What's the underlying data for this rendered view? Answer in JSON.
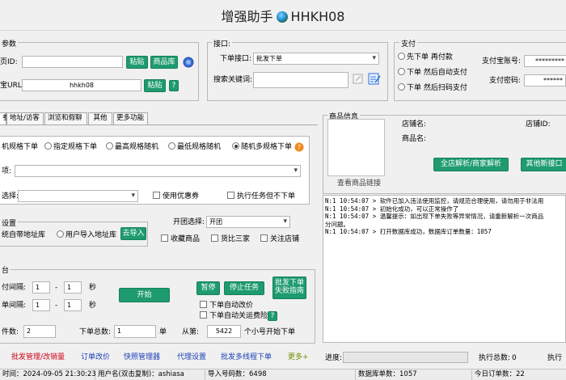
{
  "window": {
    "title_prefix": "增强助手",
    "title_suffix": "HHKH08"
  },
  "params": {
    "group_label": "参数",
    "page_url_label": "页ID:",
    "page_url_value": "",
    "paste_label": "粘贴",
    "product_lib_label": "商品库",
    "shop_url_label": "宝URL:",
    "shop_url_value": "hhkh08",
    "paste2_label": "粘贴",
    "help_label": "?"
  },
  "interface": {
    "group_label": "接口:",
    "order_interface_label": "下单接口:",
    "order_interface_value": "批发下单",
    "keyword_label": "搜索关键词:",
    "keyword_value": ""
  },
  "payment": {
    "group_label": "支付",
    "options": [
      "先下单 再付款",
      "下单 然后自动支付",
      "下单 然后扫码支付"
    ],
    "alipay_account_label": "支付宝账号:",
    "alipay_account_value": "*********",
    "pay_password_label": "支付密码:",
    "pay_password_value": "******"
  },
  "tabs": [
    "参",
    "地址/访客",
    "浏览和假聊",
    "其他",
    "更多功能"
  ],
  "spec": {
    "options": [
      "机规格下单",
      "指定规格下单",
      "最高规格随机",
      "最低规格随机",
      "随机多规格下单"
    ],
    "help": "?",
    "spec_label": "项:",
    "select_label": "选择:",
    "coupon_label": "使用优惠券",
    "exec_task_label": "执行任务但不下单"
  },
  "address": {
    "group_label": "设置",
    "opt1": "统自带地址库",
    "opt2": "用户导入地址库",
    "import_button": "去导入",
    "group_buy_label": "开团选择:",
    "group_buy_value": "开团",
    "fav_label": "收藏商品",
    "compare_label": "货比三家",
    "follow_label": "关注店铺"
  },
  "task": {
    "group_label": "台",
    "pay_interval_label": "付间隔:",
    "pay_interval_from": "1",
    "pay_interval_to": "1",
    "sec1": "秒",
    "order_interval_label": "单间隔:",
    "order_interval_from": "1",
    "order_interval_to": "1",
    "sec2": "秒",
    "start_button": "开始",
    "pause_button": "暂停",
    "stop_button": "停止任务",
    "batch_guide_button_1": "批发下单",
    "batch_guide_button_2": "失败指南",
    "auto_price_label": "下单自动改价",
    "auto_follow_label": "下单自动关运费险",
    "help": "?",
    "count_label": "件数:",
    "count_value": "2",
    "total_label": "下单总数:",
    "total_value": "1",
    "unit": "单",
    "from_label": "从第:",
    "from_value": "5422",
    "from_suffix": "个小号开始下单"
  },
  "product": {
    "group_label": "商品信息",
    "view_link": "查看商品链接",
    "shop_name_label": "店铺名:",
    "shop_id_label": "店铺ID:",
    "product_name_label": "商品名:",
    "full_parse_button": "全店解析/商家解析",
    "other_parse_button": "其他新接口"
  },
  "log_lines": [
    "N:1 10:54:07 > 软件已加入违法使用监控，请规范合理使用，请勿用于非法用",
    "N:1 10:54:07 > 初始化成功，可以正常操作了",
    "N:1 10:54:07 > 温馨提示：如出现下单失败等异常情况，请重新解析一次商品",
    "分问题。",
    "N:1 10:54:07 > 打开数据库成功，数据库订单数量：1057"
  ],
  "bottom_links": [
    {
      "label": "批发管理/改销量",
      "color": "#d0021b"
    },
    {
      "label": "订单改价",
      "color": "#1a3fb8"
    },
    {
      "label": "快照管理器",
      "color": "#1a3fb8"
    },
    {
      "label": "代理设置",
      "color": "#1a3fb8"
    },
    {
      "label": "批发多线程下单",
      "color": "#1a3fb8"
    },
    {
      "label": "更多+",
      "color": "#6b8e00"
    }
  ],
  "progress": {
    "label": "进度:",
    "executed_label": "执行总数:",
    "executed_value": "0",
    "exec_label": "执行"
  },
  "status": {
    "time": "时间：2024-09-05 21:30:23",
    "user": "用户名(双击复制)：ashiasa",
    "import_count": "导入号码数：6498",
    "db_orders": "数据库单数：1057",
    "today_orders": "今日订单数：22"
  }
}
